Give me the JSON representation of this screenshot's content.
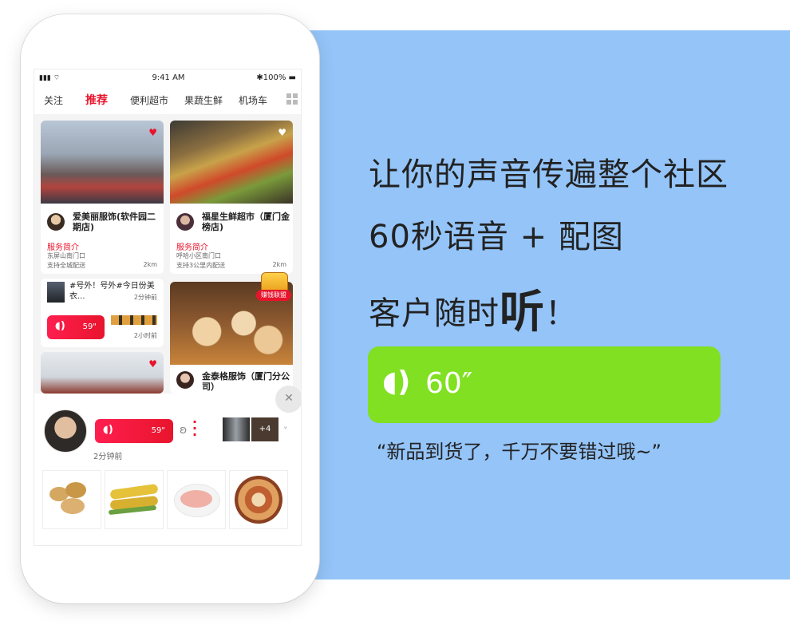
{
  "status_bar": {
    "time": "9:41 AM",
    "battery": "100%"
  },
  "tabs": [
    "关注",
    "推荐",
    "便利超市",
    "果蔬生鲜",
    "机场车"
  ],
  "cards": [
    {
      "name": "爱美丽服饰(软件园二期店)",
      "service_label": "服务简介",
      "address": "东屏山南门口",
      "delivery": "支持全城配送",
      "distance": "2km"
    },
    {
      "name": "福星生鲜超市（厦门金榜店)",
      "service_label": "服务简介",
      "address": "呼哈小区南门口",
      "delivery": "支持3公里内配送",
      "distance": "2km"
    },
    {
      "name": "金泰格服饰（厦门分公司）"
    }
  ],
  "post": {
    "text": "#号外！号外#今日份美衣...",
    "time": "2分钟前",
    "voice_duration": "59\"",
    "voice_time": "2小时前"
  },
  "badge": "赚钱联盟",
  "player": {
    "voice_duration": "59\"",
    "time": "2分钟前",
    "more_count": "+4"
  },
  "headline": {
    "line1": "让你的声音传遍整个社区",
    "line2": "60秒语音 + 配图",
    "line3_prefix": "客户随时",
    "line3_big": "听",
    "line3_suffix": "！"
  },
  "promo_voice": {
    "duration": "60″"
  },
  "quote": "“新品到货了，千万不要错过哦~”",
  "colors": {
    "accent": "#e8142c",
    "panel_blue": "#94c4f8",
    "promo_green": "#80e021"
  }
}
